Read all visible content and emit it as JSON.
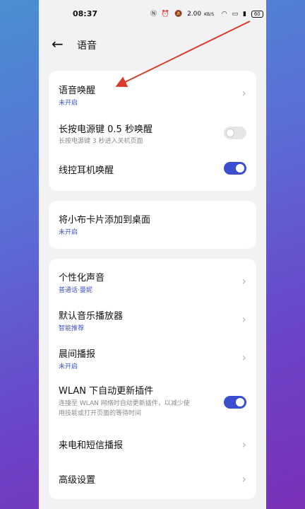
{
  "status": {
    "time": "08:37",
    "speed": "2.00",
    "speed_unit": "KB/S",
    "battery": "60"
  },
  "header": {
    "title": "语音"
  },
  "card1": {
    "voice_wakeup": {
      "title": "语音唤醒",
      "sub": "未开启"
    },
    "power_key": {
      "title": "长按电源键 0.5 秒唤醒",
      "sub": "长按电源键 3 秒进入关机页面",
      "enabled": false
    },
    "headset": {
      "title": "线控耳机唤醒",
      "enabled": true
    }
  },
  "card2": {
    "widget": {
      "title": "将小布卡片添加到桌面",
      "sub": "未开启"
    }
  },
  "card3": {
    "personal_voice": {
      "title": "个性化声音",
      "sub": "普通话·曼妮"
    },
    "music_player": {
      "title": "默认音乐播放器",
      "sub": "智能推荐"
    },
    "morning_news": {
      "title": "晨间播报",
      "sub": "未开启"
    },
    "wlan_update": {
      "title": "WLAN 下自动更新插件",
      "sub_line1": "连接至 WLAN 网络时自动更新插件，以减少使",
      "sub_line2": "用技能或打开页面的等待时间",
      "enabled": true
    },
    "call_sms": {
      "title": "来电和短信播报"
    },
    "advanced": {
      "title": "高级设置"
    }
  },
  "icons": {
    "back": "back-arrow-icon",
    "chevron": "chevron-right-icon"
  },
  "colors": {
    "accent": "#3a4fd0",
    "annotation": "#d93a2a"
  }
}
